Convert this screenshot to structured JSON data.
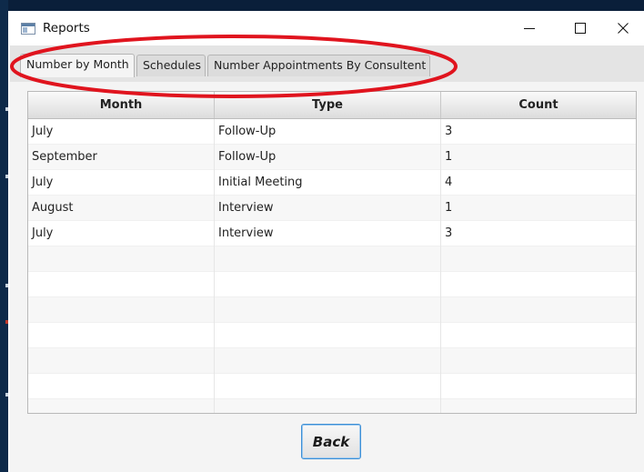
{
  "window": {
    "title": "Reports",
    "icon": "app-window-icon",
    "controls": [
      "minimize-icon",
      "maximize-icon",
      "close-icon"
    ]
  },
  "tabs": [
    {
      "label": "Number by Month",
      "selected": true
    },
    {
      "label": "Schedules",
      "selected": false
    },
    {
      "label": "Number Appointments By Consultent",
      "selected": false
    }
  ],
  "table": {
    "columns": [
      "Month",
      "Type",
      "Count"
    ],
    "rows": [
      [
        "July",
        "Follow-Up",
        "3"
      ],
      [
        "September",
        "Follow-Up",
        "1"
      ],
      [
        "July",
        "Initial Meeting",
        "4"
      ],
      [
        "August",
        "Interview",
        "1"
      ],
      [
        "July",
        "Interview",
        "3"
      ],
      [
        "",
        "",
        ""
      ],
      [
        "",
        "",
        ""
      ],
      [
        "",
        "",
        ""
      ],
      [
        "",
        "",
        ""
      ],
      [
        "",
        "",
        ""
      ],
      [
        "",
        "",
        ""
      ],
      [
        "",
        "",
        ""
      ]
    ]
  },
  "footer": {
    "back_label": "Back"
  },
  "colors": {
    "annotation_ellipse": "#e0141e",
    "focus_border": "#3c8fd6",
    "desktop_edge": "#0e2a4a"
  }
}
